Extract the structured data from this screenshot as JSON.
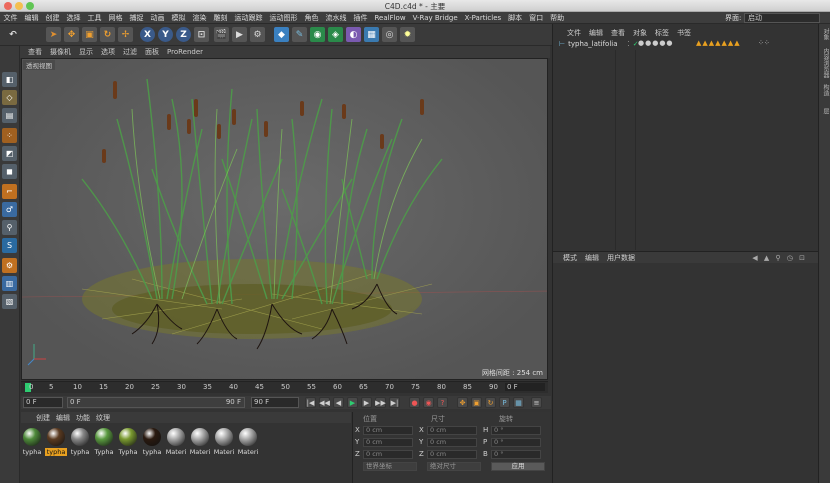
{
  "window": {
    "title": "C4D.c4d * - 主要"
  },
  "menubar": {
    "items": [
      "文件",
      "编辑",
      "创建",
      "选择",
      "工具",
      "网格",
      "捕捉",
      "动画",
      "模拟",
      "渲染",
      "雕刻",
      "运动跟踪",
      "运动图形",
      "角色",
      "流水线",
      "插件",
      "RealFlow",
      "V-Ray Bridge",
      "X-Particles",
      "脚本",
      "窗口",
      "帮助"
    ],
    "layout_label": "界面:",
    "layout_value": "启动"
  },
  "viewport": {
    "menu": [
      "查看",
      "摄像机",
      "显示",
      "选项",
      "过滤",
      "面板",
      "ProRender"
    ],
    "label": "透视视图",
    "grid_text": "网格间距 : 254 cm"
  },
  "timeline": {
    "ticks": [
      "0",
      "5",
      "10",
      "15",
      "20",
      "25",
      "30",
      "35",
      "40",
      "45",
      "50",
      "55",
      "60",
      "65",
      "70",
      "75",
      "80",
      "85",
      "90"
    ],
    "current_frame": "0 F"
  },
  "controls": {
    "start_field": "0 F",
    "slider_start": "0 F",
    "slider_end": "90 F",
    "end_field": "90 F"
  },
  "materials": {
    "menu": [
      "创建",
      "编辑",
      "功能",
      "纹理"
    ],
    "items": [
      {
        "label": "typha",
        "color": "#4e8a3a"
      },
      {
        "label": "typha",
        "color": "#5a3a20",
        "selected": true
      },
      {
        "label": "typha",
        "color": "#888888"
      },
      {
        "label": "Typha",
        "color": "#5a9a40"
      },
      {
        "label": "Typha",
        "color": "#7a9a30"
      },
      {
        "label": "typha",
        "color": "#2a1a10"
      },
      {
        "label": "Materi",
        "color": "#aaaaaa"
      },
      {
        "label": "Materi",
        "color": "#aaaaaa"
      },
      {
        "label": "Materi",
        "color": "#aaaaaa"
      },
      {
        "label": "Materi",
        "color": "#aaaaaa"
      }
    ]
  },
  "coordinates": {
    "header": [
      "位置",
      "尺寸",
      "旋转"
    ],
    "rows": [
      {
        "axis": "X",
        "pos": "0 cm",
        "size": "0 cm",
        "rot_axis": "H",
        "rot": "0 °"
      },
      {
        "axis": "Y",
        "pos": "0 cm",
        "size": "0 cm",
        "rot_axis": "P",
        "rot": "0 °"
      },
      {
        "axis": "Z",
        "pos": "0 cm",
        "size": "0 cm",
        "rot_axis": "B",
        "rot": "0 °"
      }
    ],
    "mode1": "世界坐标",
    "mode2": "绝对尺寸",
    "apply": "应用"
  },
  "object_manager": {
    "menu": [
      "文件",
      "编辑",
      "查看",
      "对象",
      "标签",
      "书签"
    ],
    "object_name": "typha_latifolia"
  },
  "attribute_manager": {
    "menu": [
      "模式",
      "编辑",
      "用户数据"
    ]
  },
  "right_tabs": [
    "对象",
    "内容浏览器",
    "构造",
    "层"
  ]
}
